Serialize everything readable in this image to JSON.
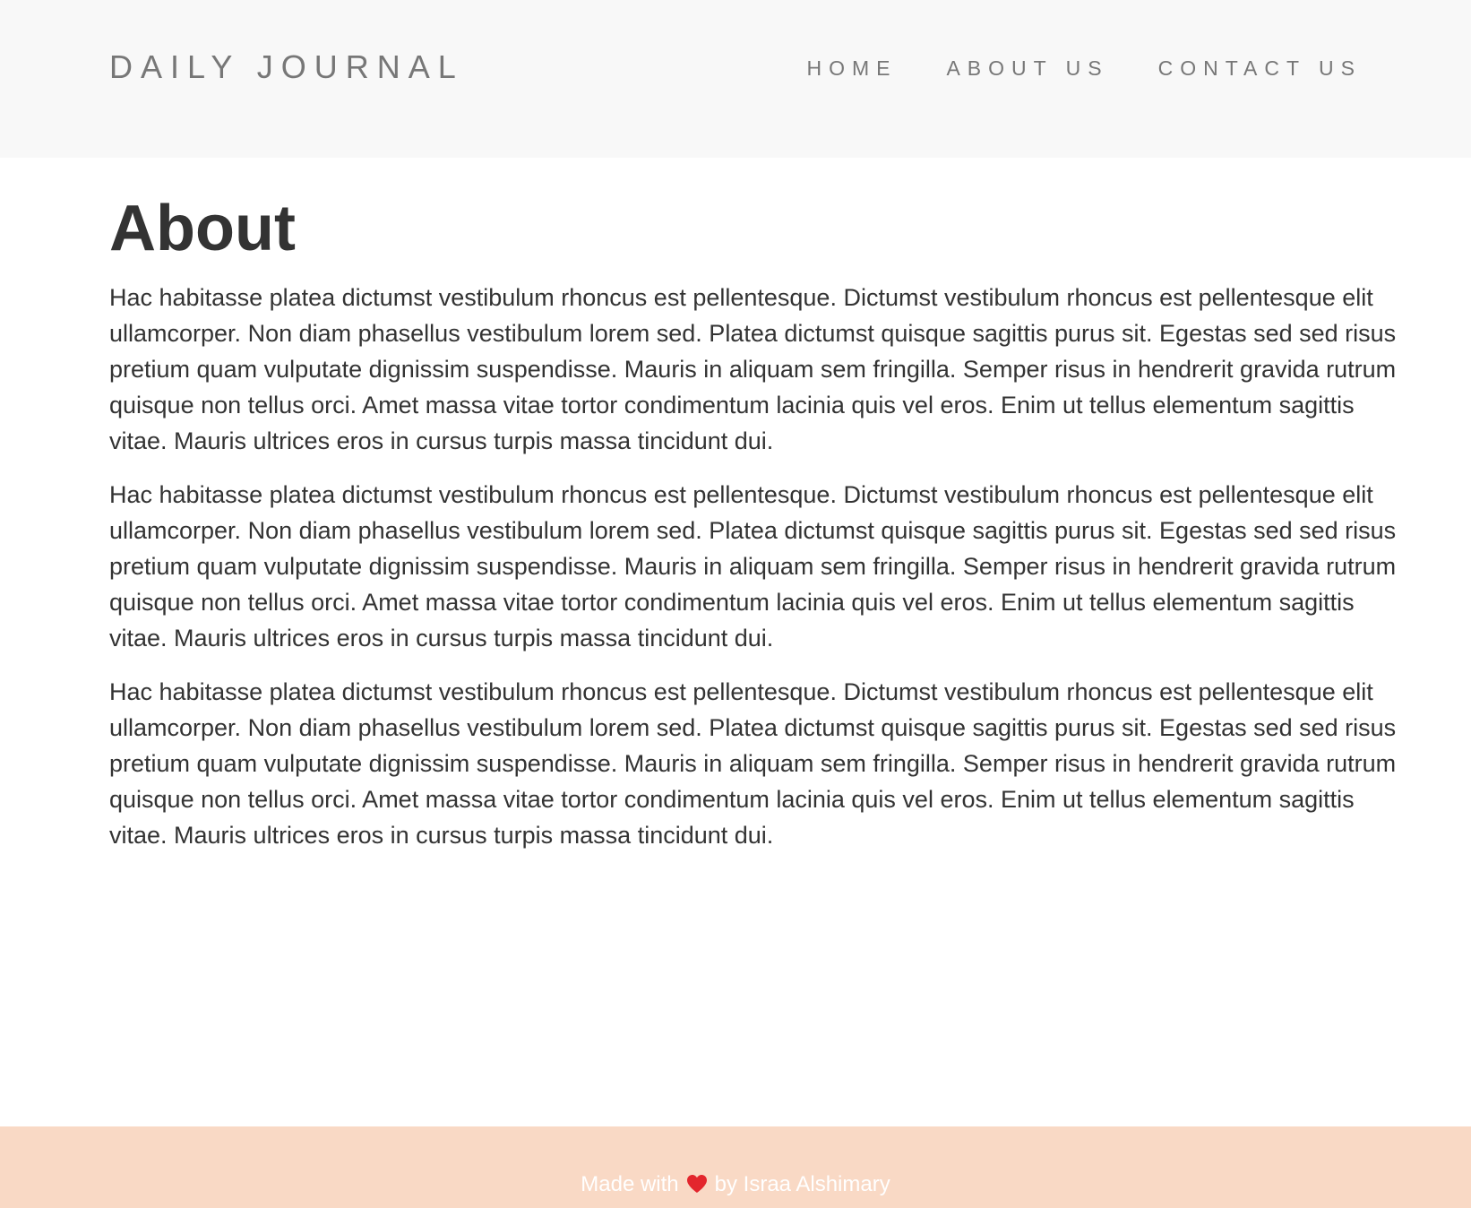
{
  "header": {
    "brand": "DAILY JOURNAL",
    "nav": [
      {
        "label": "HOME"
      },
      {
        "label": "ABOUT US"
      },
      {
        "label": "CONTACT US"
      }
    ]
  },
  "main": {
    "title": "About",
    "paragraphs": [
      "Hac habitasse platea dictumst vestibulum rhoncus est pellentesque. Dictumst vestibulum rhoncus est pellentesque elit ullamcorper. Non diam phasellus vestibulum lorem sed. Platea dictumst quisque sagittis purus sit. Egestas sed sed risus pretium quam vulputate dignissim suspendisse. Mauris in aliquam sem fringilla. Semper risus in hendrerit gravida rutrum quisque non tellus orci. Amet massa vitae tortor condimentum lacinia quis vel eros. Enim ut tellus elementum sagittis vitae. Mauris ultrices eros in cursus turpis massa tincidunt dui.",
      "Hac habitasse platea dictumst vestibulum rhoncus est pellentesque. Dictumst vestibulum rhoncus est pellentesque elit ullamcorper. Non diam phasellus vestibulum lorem sed. Platea dictumst quisque sagittis purus sit. Egestas sed sed risus pretium quam vulputate dignissim suspendisse. Mauris in aliquam sem fringilla. Semper risus in hendrerit gravida rutrum quisque non tellus orci. Amet massa vitae tortor condimentum lacinia quis vel eros. Enim ut tellus elementum sagittis vitae. Mauris ultrices eros in cursus turpis massa tincidunt dui.",
      "Hac habitasse platea dictumst vestibulum rhoncus est pellentesque. Dictumst vestibulum rhoncus est pellentesque elit ullamcorper. Non diam phasellus vestibulum lorem sed. Platea dictumst quisque sagittis purus sit. Egestas sed sed risus pretium quam vulputate dignissim suspendisse. Mauris in aliquam sem fringilla. Semper risus in hendrerit gravida rutrum quisque non tellus orci. Amet massa vitae tortor condimentum lacinia quis vel eros. Enim ut tellus elementum sagittis vitae. Mauris ultrices eros in cursus turpis massa tincidunt dui."
    ]
  },
  "footer": {
    "prefix": "Made with",
    "icon": "heart-icon",
    "suffix": "by Israa Alshimary"
  },
  "colors": {
    "navbar_bg": "#f8f8f8",
    "footer_bg": "#f9d9c5",
    "text": "#333333",
    "nav_text": "#777777",
    "heart": "#e3262d"
  }
}
